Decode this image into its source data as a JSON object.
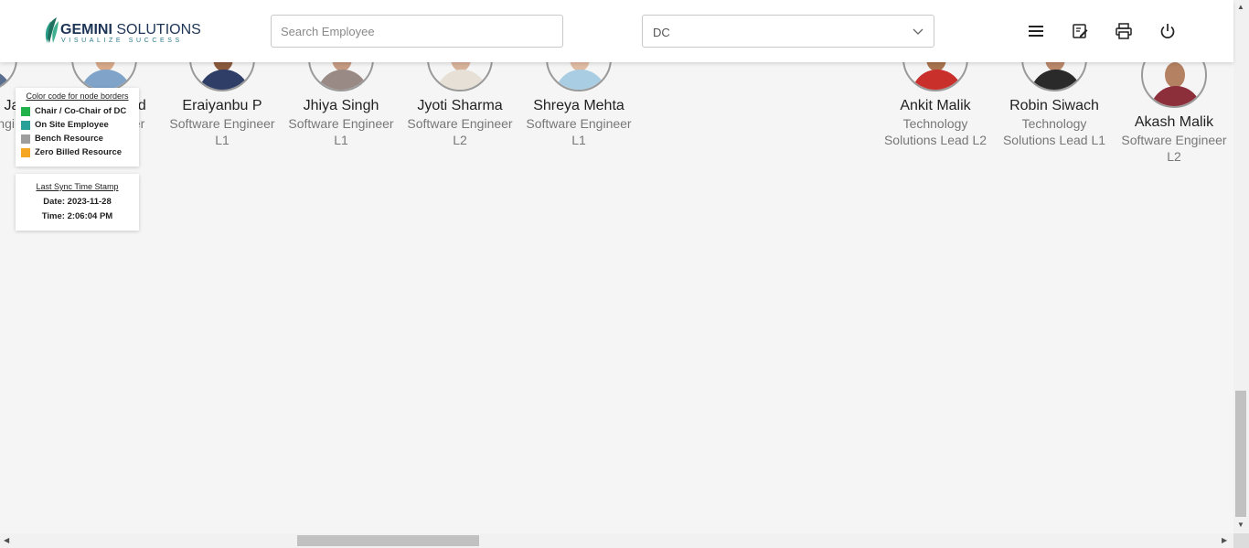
{
  "header": {
    "logo": {
      "brand_bold": "GEMINI",
      "brand_light": "SOLUTIONS",
      "tagline": "VISUALIZE SUCCESS"
    },
    "search": {
      "placeholder": "Search Employee",
      "value": ""
    },
    "dc_select": {
      "value": "DC"
    },
    "icons": [
      "menu-icon",
      "edit-note-icon",
      "print-icon",
      "power-icon"
    ]
  },
  "legend": {
    "title": "Color code for node borders",
    "items": [
      {
        "label": "Chair / Co-Chair of DC",
        "color": "#22b24c"
      },
      {
        "label": "On Site Employee",
        "color": "#2aa198"
      },
      {
        "label": "Bench Resource",
        "color": "#9e9e9e"
      },
      {
        "label": "Zero Billed Resource",
        "color": "#f5a623"
      }
    ]
  },
  "sync": {
    "title": "Last Sync Time Stamp",
    "date": "Date: 2023-11-28",
    "time": "Time: 2:06:04 PM"
  },
  "employees": [
    {
      "name": "Jai",
      "role": "Engi"
    },
    {
      "name": "ad",
      "role": "eer"
    },
    {
      "name": "Eraiyanbu P",
      "role": "Software Engineer L1"
    },
    {
      "name": "Jhiya Singh",
      "role": "Software Engineer L1"
    },
    {
      "name": "Jyoti Sharma",
      "role": "Software Engineer L2"
    },
    {
      "name": "Shreya Mehta",
      "role": "Software Engineer L1"
    },
    {
      "name": "Ankit Malik",
      "role": "Technology Solutions Lead L2"
    },
    {
      "name": "Robin Siwach",
      "role": "Technology Solutions Lead L1"
    },
    {
      "name": "Akash Malik",
      "role": "Software Engineer L2"
    }
  ],
  "colors": {
    "topbar": "#ffffff",
    "page_bg": "#f5f5f5",
    "brand": "#1d3557",
    "leaf": "#2b9e8a"
  }
}
